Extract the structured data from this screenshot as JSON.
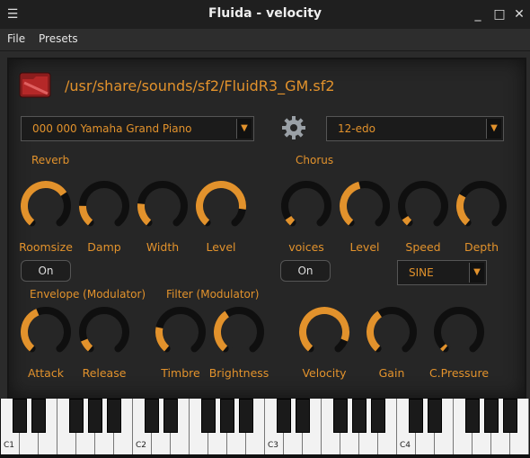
{
  "window": {
    "title": "Fluida - velocity"
  },
  "menu": {
    "file": "File",
    "presets": "Presets"
  },
  "soundfont": {
    "path": "/usr/share/sounds/sf2/FluidR3_GM.sf2"
  },
  "instrument": {
    "selected": "000 000 Yamaha Grand Piano"
  },
  "tuning": {
    "selected": "12-edo"
  },
  "reverb": {
    "label": "Reverb",
    "on_label": "On",
    "knobs": [
      {
        "label": "Roomsize",
        "value": 0.7
      },
      {
        "label": "Damp",
        "value": 0.18
      },
      {
        "label": "Width",
        "value": 0.2
      },
      {
        "label": "Level",
        "value": 0.85
      }
    ]
  },
  "chorus": {
    "label": "Chorus",
    "on_label": "On",
    "waveform": "SINE",
    "knobs": [
      {
        "label": "voices",
        "value": 0.06
      },
      {
        "label": "Level",
        "value": 0.45
      },
      {
        "label": "Speed",
        "value": 0.06
      },
      {
        "label": "Depth",
        "value": 0.28
      }
    ]
  },
  "envelope": {
    "label": "Envelope (Modulator)",
    "knobs": [
      {
        "label": "Attack",
        "value": 0.42
      },
      {
        "label": "Release",
        "value": 0.1
      }
    ]
  },
  "filter": {
    "label": "Filter (Modulator)",
    "knobs": [
      {
        "label": "Timbre",
        "value": 0.22
      },
      {
        "label": "Brightness",
        "value": 0.38
      }
    ]
  },
  "output": {
    "knobs": [
      {
        "label": "Velocity",
        "value": 0.9
      },
      {
        "label": "Gain",
        "value": 0.38
      },
      {
        "label": "C.Pressure",
        "value": 0.0
      }
    ]
  },
  "keyboard": {
    "octave_labels": [
      "C1",
      "C2",
      "C3",
      "C4"
    ]
  },
  "colors": {
    "accent": "#e2922c",
    "knob_track": "#0f0f0f",
    "background": "#262626"
  }
}
